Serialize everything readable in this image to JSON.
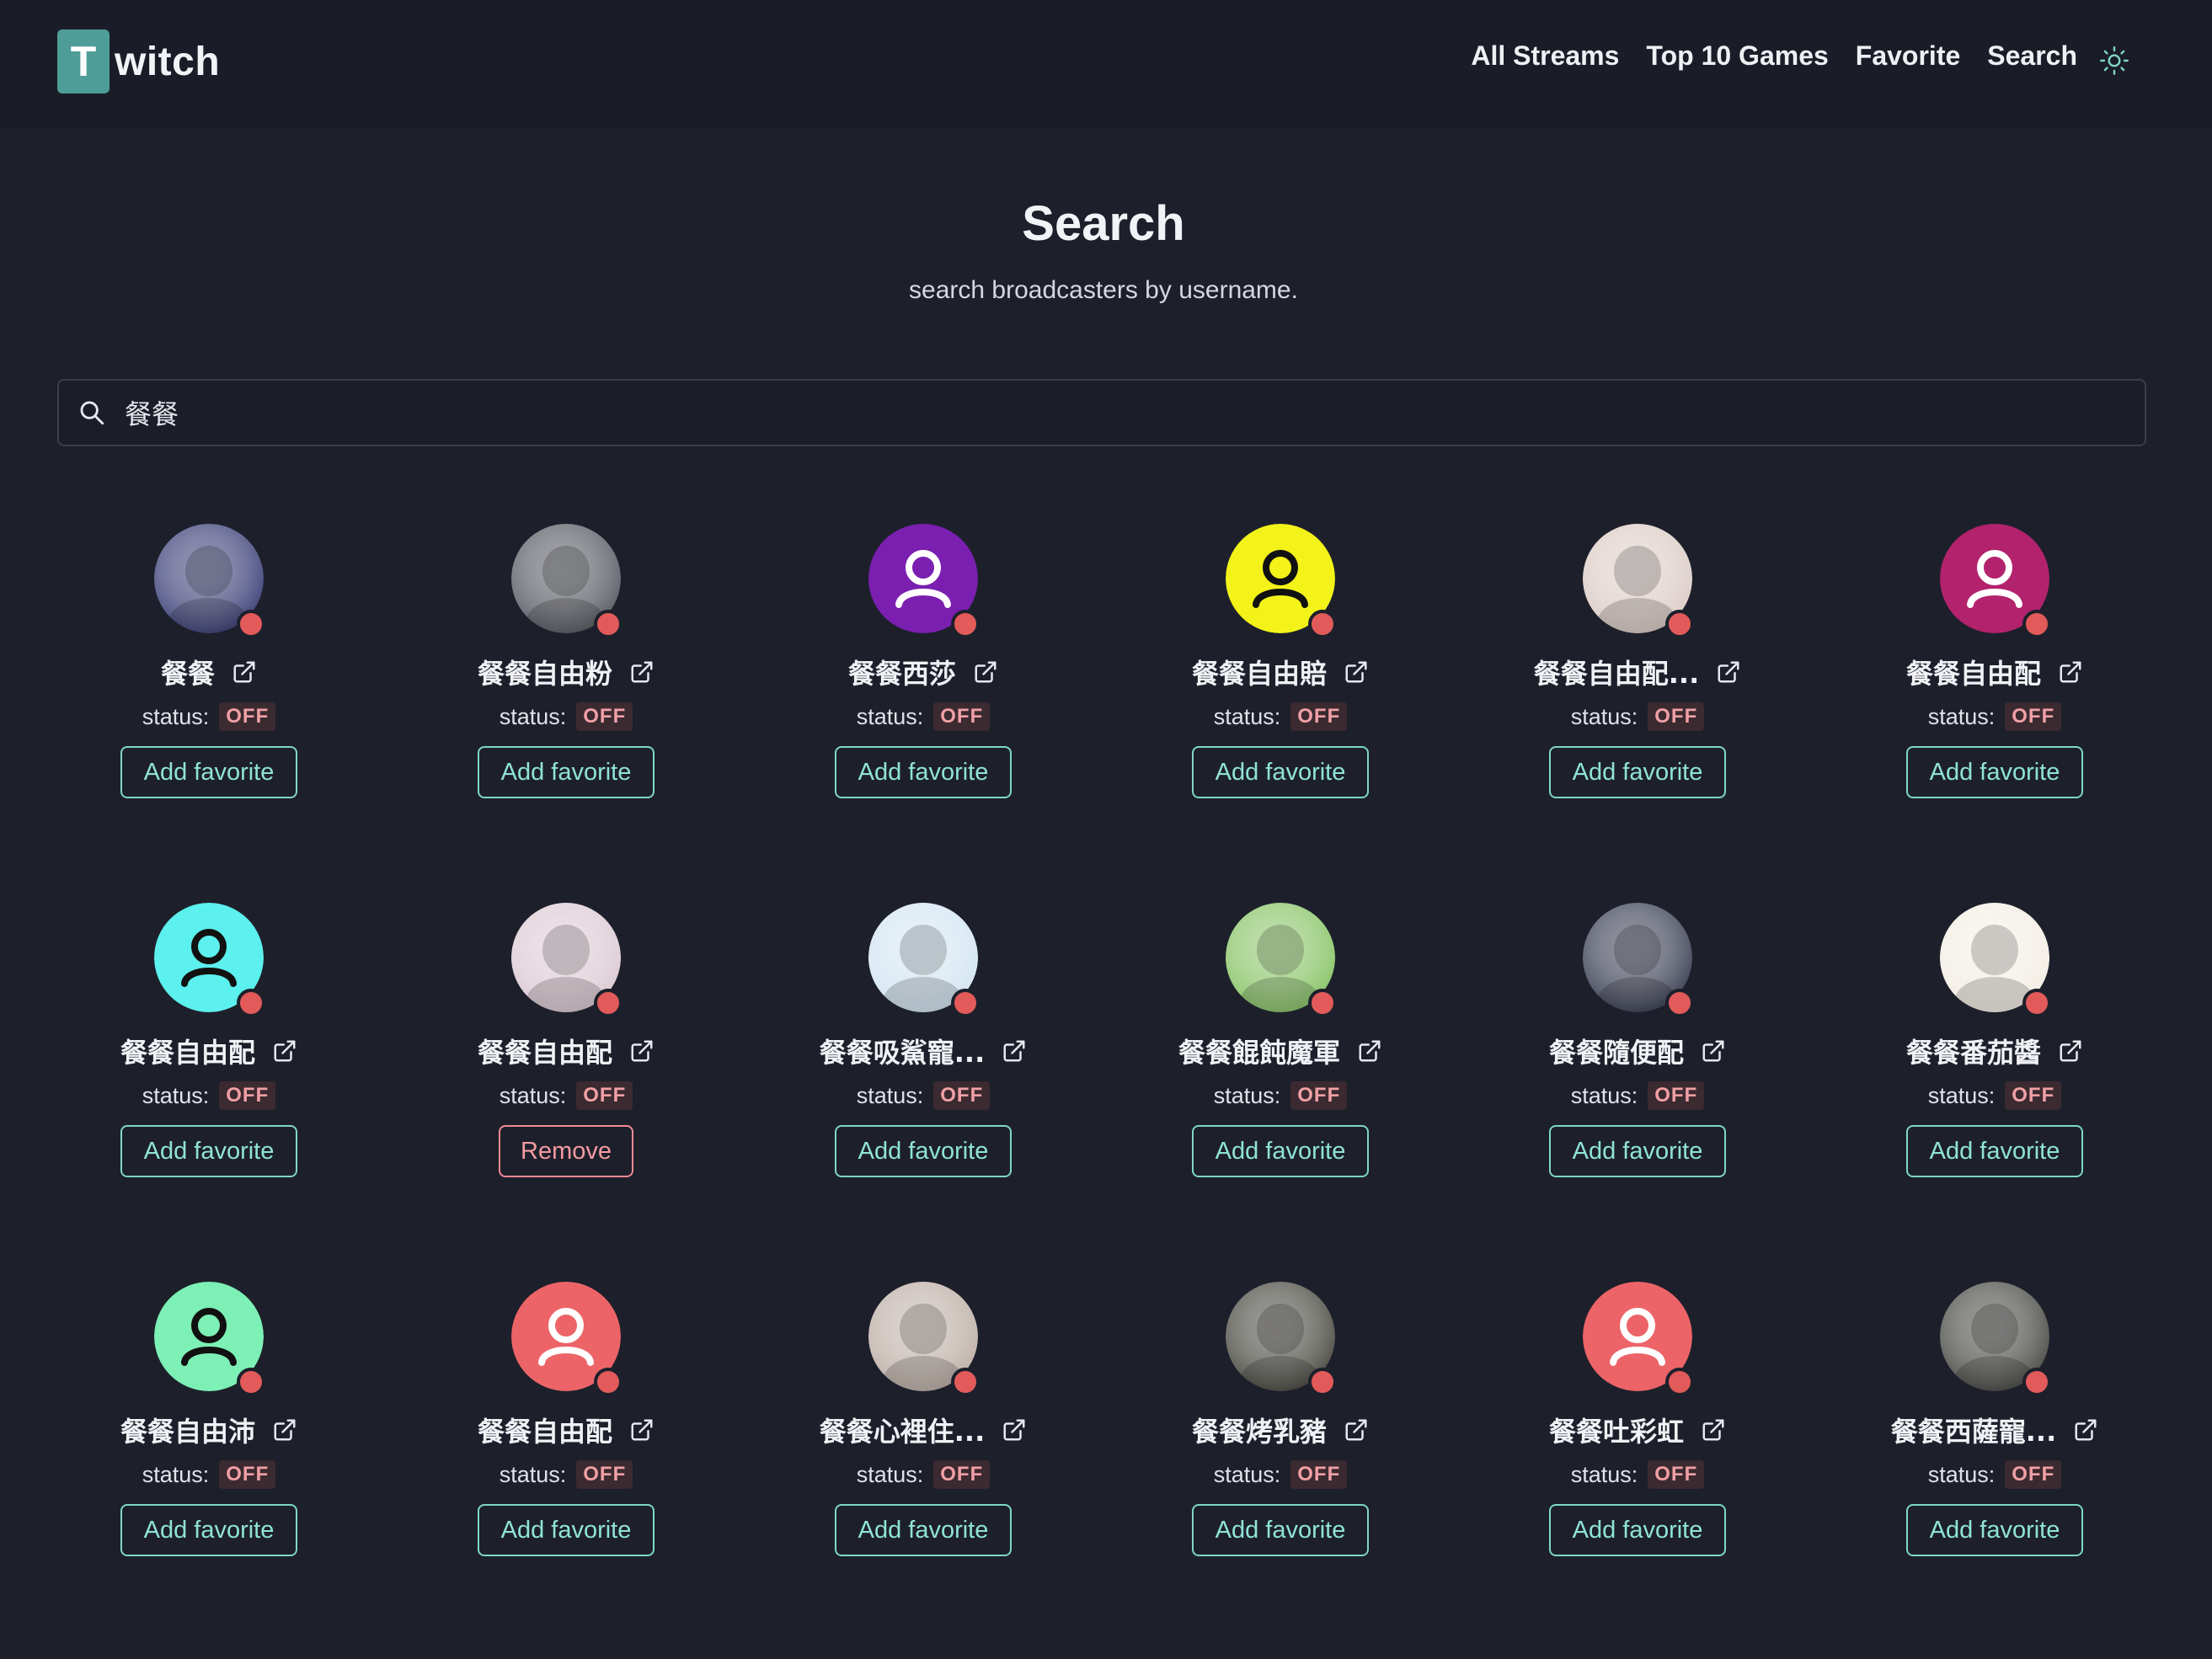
{
  "header": {
    "logo_letter": "T",
    "logo_rest": "witch",
    "nav": [
      "All Streams",
      "Top 10 Games",
      "Favorite",
      "Search"
    ],
    "theme_icon": "sun-icon"
  },
  "page": {
    "title": "Search",
    "subtitle": "search broadcasters by username."
  },
  "search": {
    "value": "餐餐",
    "placeholder": ""
  },
  "colors": {
    "accent": "#7fd6c8",
    "danger": "#f08a93",
    "offline_dot": "#e25a5a",
    "logo": "#4f9d98"
  },
  "status_label": "status:",
  "results": [
    {
      "name": "餐餐",
      "status": "OFF",
      "button": "Add favorite",
      "avatar": "photo-dark-blue",
      "avatar_color": "#2b2f6b"
    },
    {
      "name": "餐餐自由粉",
      "status": "OFF",
      "button": "Add favorite",
      "avatar": "anime-cat-girl",
      "avatar_color": "#4a4d56"
    },
    {
      "name": "餐餐西莎",
      "status": "OFF",
      "button": "Add favorite",
      "avatar": "default-user",
      "avatar_color": "#7a1fb0"
    },
    {
      "name": "餐餐自由賠",
      "status": "OFF",
      "button": "Add favorite",
      "avatar": "default-user",
      "avatar_color": "#f3f31a"
    },
    {
      "name": "餐餐自由配...",
      "status": "OFF",
      "button": "Add favorite",
      "avatar": "pink-pig",
      "avatar_color": "#d9c8c2"
    },
    {
      "name": "餐餐自由配",
      "status": "OFF",
      "button": "Add favorite",
      "avatar": "default-user",
      "avatar_color": "#b3226d"
    },
    {
      "name": "餐餐自由配",
      "status": "OFF",
      "button": "Add favorite",
      "avatar": "default-user",
      "avatar_color": "#5cf0ee"
    },
    {
      "name": "餐餐自由配",
      "status": "OFF",
      "button": "Remove",
      "avatar": "anime-character",
      "avatar_color": "#d9c6d0"
    },
    {
      "name": "餐餐吸鯊寵...",
      "status": "OFF",
      "button": "Add favorite",
      "avatar": "anime-blue-hair",
      "avatar_color": "#cfe3f0"
    },
    {
      "name": "餐餐餛飩魔軍",
      "status": "OFF",
      "button": "Add favorite",
      "avatar": "cartoon-glasses-man",
      "avatar_color": "#7fbf5a"
    },
    {
      "name": "餐餐隨便配",
      "status": "OFF",
      "button": "Add favorite",
      "avatar": "anime-warrior",
      "avatar_color": "#2a2f44"
    },
    {
      "name": "餐餐番茄醬",
      "status": "OFF",
      "button": "Add favorite",
      "avatar": "cartoon-food",
      "avatar_color": "#f2ece2"
    },
    {
      "name": "餐餐自由沛",
      "status": "OFF",
      "button": "Add favorite",
      "avatar": "default-user",
      "avatar_color": "#7df0b5"
    },
    {
      "name": "餐餐自由配",
      "status": "OFF",
      "button": "Add favorite",
      "avatar": "default-user",
      "avatar_color": "#ec6468"
    },
    {
      "name": "餐餐心裡住...",
      "status": "OFF",
      "button": "Add favorite",
      "avatar": "photo-girl",
      "avatar_color": "#b8a9a0"
    },
    {
      "name": "餐餐烤乳豬",
      "status": "OFF",
      "button": "Add favorite",
      "avatar": "minecraft-creeper",
      "avatar_color": "#3b3a32"
    },
    {
      "name": "餐餐吐彩虹",
      "status": "OFF",
      "button": "Add favorite",
      "avatar": "default-user",
      "avatar_color": "#ec6468"
    },
    {
      "name": "餐餐西薩寵...",
      "status": "OFF",
      "button": "Add favorite",
      "avatar": "snowy-owl",
      "avatar_color": "#3a3a36"
    }
  ]
}
